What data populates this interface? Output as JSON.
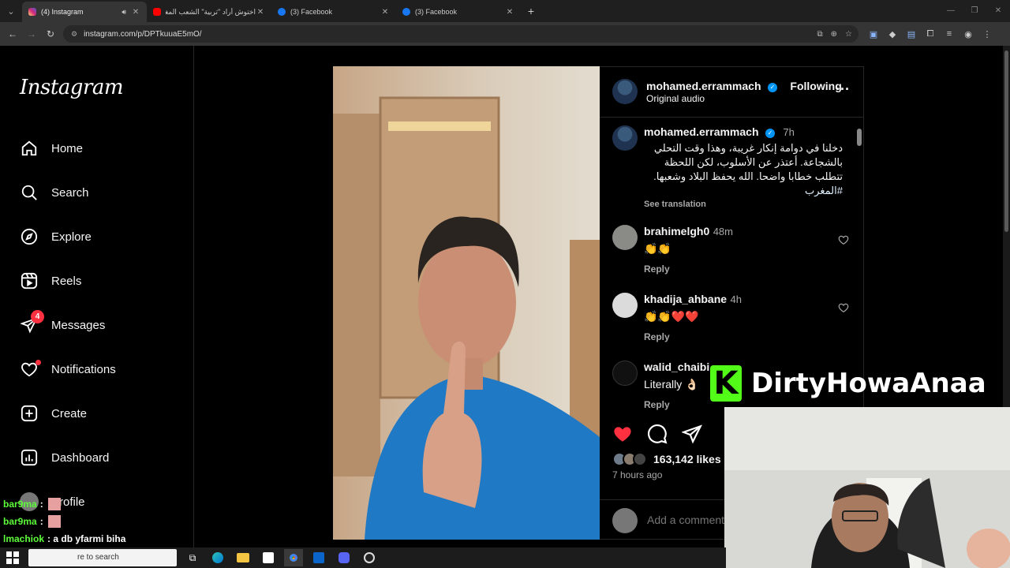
{
  "browser": {
    "tabs": [
      {
        "title": "(4) Instagram",
        "color": "#e1306c",
        "active": true
      },
      {
        "title": "اختوش أراد \"تربية\" الشعب المغر...",
        "color": "#ff0000",
        "active": false
      },
      {
        "title": "(3) Facebook",
        "color": "#1877f2",
        "active": false
      },
      {
        "title": "(3) Facebook",
        "color": "#1877f2",
        "active": false
      }
    ],
    "new_tab": "+",
    "url": "instagram.com/p/DPTkuuaE5mO/"
  },
  "sidebar": {
    "logo": "Instagram",
    "items": [
      {
        "label": "Home",
        "icon": "home-icon"
      },
      {
        "label": "Search",
        "icon": "search-icon"
      },
      {
        "label": "Explore",
        "icon": "compass-icon"
      },
      {
        "label": "Reels",
        "icon": "reels-icon"
      },
      {
        "label": "Messages",
        "icon": "messenger-icon",
        "badge": "4"
      },
      {
        "label": "Notifications",
        "icon": "heart-icon"
      },
      {
        "label": "Create",
        "icon": "plus-square-icon"
      },
      {
        "label": "Dashboard",
        "icon": "chart-icon"
      },
      {
        "label": "Profile",
        "icon": "avatar"
      }
    ]
  },
  "post": {
    "author": "mohamed.errammach",
    "follow_label": "Following",
    "audio": "Original audio",
    "caption_time": "7h",
    "caption": "دخلنا في دوامة إنكار غريبة، وهذا وقت التحلي بالشجاعة. أعتذر عن الأسلوب، لكن اللحظة تتطلب خطابا واضحا. الله يحفظ البلاد وشعبها.",
    "hashtag": "#المغرب",
    "see_translation": "See translation",
    "comments": [
      {
        "user": "brahimelgh0",
        "time": "48m",
        "text": "👏👏",
        "reply": "Reply"
      },
      {
        "user": "khadija_ahbane",
        "time": "4h",
        "text": "👏👏❤️❤️",
        "reply": "Reply"
      },
      {
        "user": "walid_chaibi",
        "time": "",
        "text": "Literally 👌🏻",
        "reply": "Reply"
      }
    ],
    "likes": "163,142 likes",
    "ago": "7 hours ago",
    "add_comment_placeholder": "Add a comment..."
  },
  "stream": {
    "channel": "DirtyHowaAnaa",
    "chat": [
      {
        "user": "bar9ma",
        "msg": ":"
      },
      {
        "user": "bar9ma",
        "msg": ":"
      },
      {
        "user": "lmachiok",
        "msg": ": a db yfarmi biha"
      }
    ]
  },
  "taskbar": {
    "search_placeholder": "re to search"
  }
}
